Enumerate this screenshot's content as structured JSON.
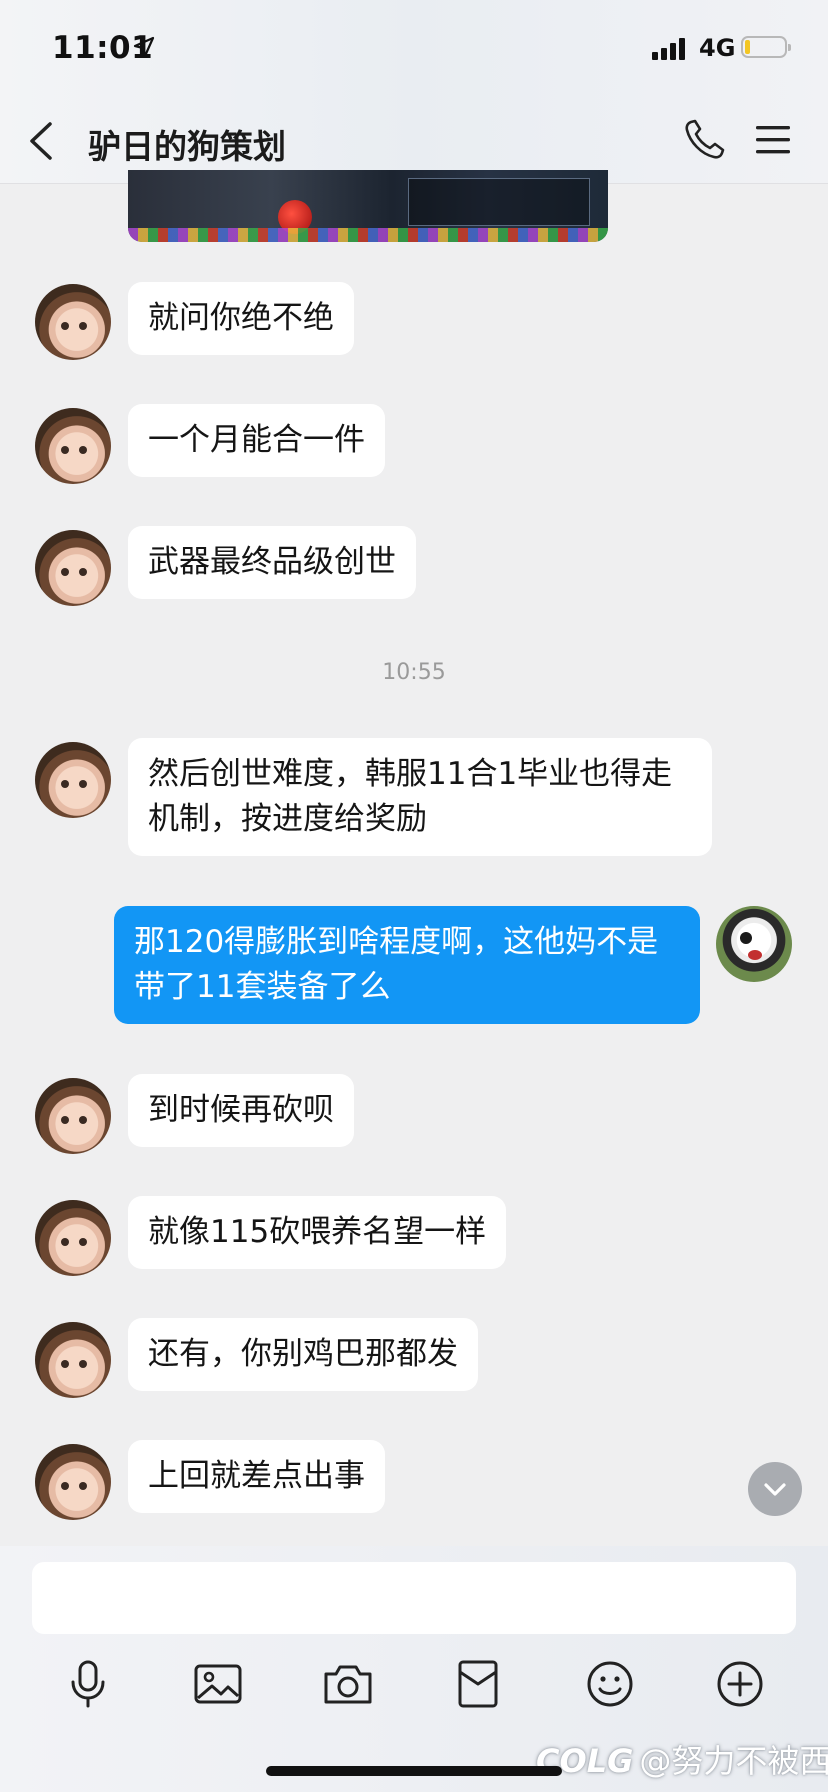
{
  "status_bar": {
    "time": "11:01",
    "network": "4G"
  },
  "header": {
    "title": "驴日的狗策划"
  },
  "messages": [
    {
      "text": "就问你绝不绝"
    },
    {
      "text": "一个月能合一件"
    },
    {
      "text": "武器最终品级创世"
    },
    {
      "text": "然后创世难度，韩服11合1毕业也得走机制，按进度给奖励"
    },
    {
      "text": "那120得膨胀到啥程度啊，这他妈不是带了11套装备了么"
    },
    {
      "text": "到时候再砍呗"
    },
    {
      "text": "就像115砍喂养名望一样"
    },
    {
      "text": "还有，你别鸡巴那都发"
    },
    {
      "text": "上回就差点出事"
    }
  ],
  "time_divider": "10:55",
  "watermark": "@努力不被西",
  "watermark_logo": "COLG",
  "toolbar_icons": [
    "microphone-icon",
    "image-icon",
    "camera-icon",
    "red-packet-icon",
    "emoji-icon",
    "plus-icon"
  ],
  "colors": {
    "self_bubble": "#1296f5",
    "other_bubble": "#ffffff",
    "background": "#efeff0"
  }
}
